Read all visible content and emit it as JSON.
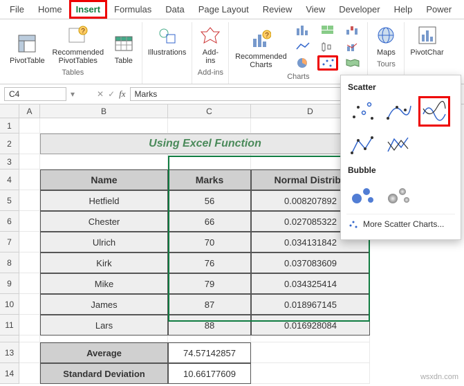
{
  "tabs": [
    "File",
    "Home",
    "Insert",
    "Formulas",
    "Data",
    "Page Layout",
    "Review",
    "View",
    "Developer",
    "Help",
    "Power"
  ],
  "active_tab": "Insert",
  "ribbon": {
    "tables": {
      "label": "Tables",
      "pivot": "PivotTable",
      "recpivot": "Recommended\nPivotTables",
      "table": "Table"
    },
    "illus": {
      "label": "Illustrations",
      "btn": "Illustrations"
    },
    "addins": {
      "label": "Add-ins",
      "btn": "Add-\nins"
    },
    "charts": {
      "label": "Charts",
      "rec": "Recommended\nCharts"
    },
    "tours": {
      "label": "Tours",
      "maps": "Maps"
    },
    "pc": {
      "btn": "PivotChar"
    }
  },
  "namebox": {
    "ref": "C4",
    "formula": "Marks"
  },
  "cols": [
    "A",
    "B",
    "C",
    "D"
  ],
  "rows": [
    "1",
    "2",
    "3",
    "4",
    "5",
    "6",
    "7",
    "8",
    "9",
    "10",
    "11",
    "",
    "13",
    "14"
  ],
  "title": "Using Excel Function",
  "headers": {
    "name": "Name",
    "marks": "Marks",
    "dist": "Normal Distribu"
  },
  "data": [
    {
      "name": "Hetfield",
      "marks": "56",
      "dist": "0.008207892"
    },
    {
      "name": "Chester",
      "marks": "66",
      "dist": "0.027085322"
    },
    {
      "name": "Ulrich",
      "marks": "70",
      "dist": "0.034131842"
    },
    {
      "name": "Kirk",
      "marks": "76",
      "dist": "0.037083609"
    },
    {
      "name": "Mike",
      "marks": "79",
      "dist": "0.034325414"
    },
    {
      "name": "James",
      "marks": "87",
      "dist": "0.018967145"
    },
    {
      "name": "Lars",
      "marks": "88",
      "dist": "0.016928084"
    }
  ],
  "stats": {
    "avg_label": "Average",
    "avg": "74.57142857",
    "sd_label": "Standard Deviation",
    "sd": "10.66177609"
  },
  "dropdown": {
    "scatter": "Scatter",
    "bubble": "Bubble",
    "more": "More Scatter Charts..."
  },
  "watermark": "wsxdn.com"
}
